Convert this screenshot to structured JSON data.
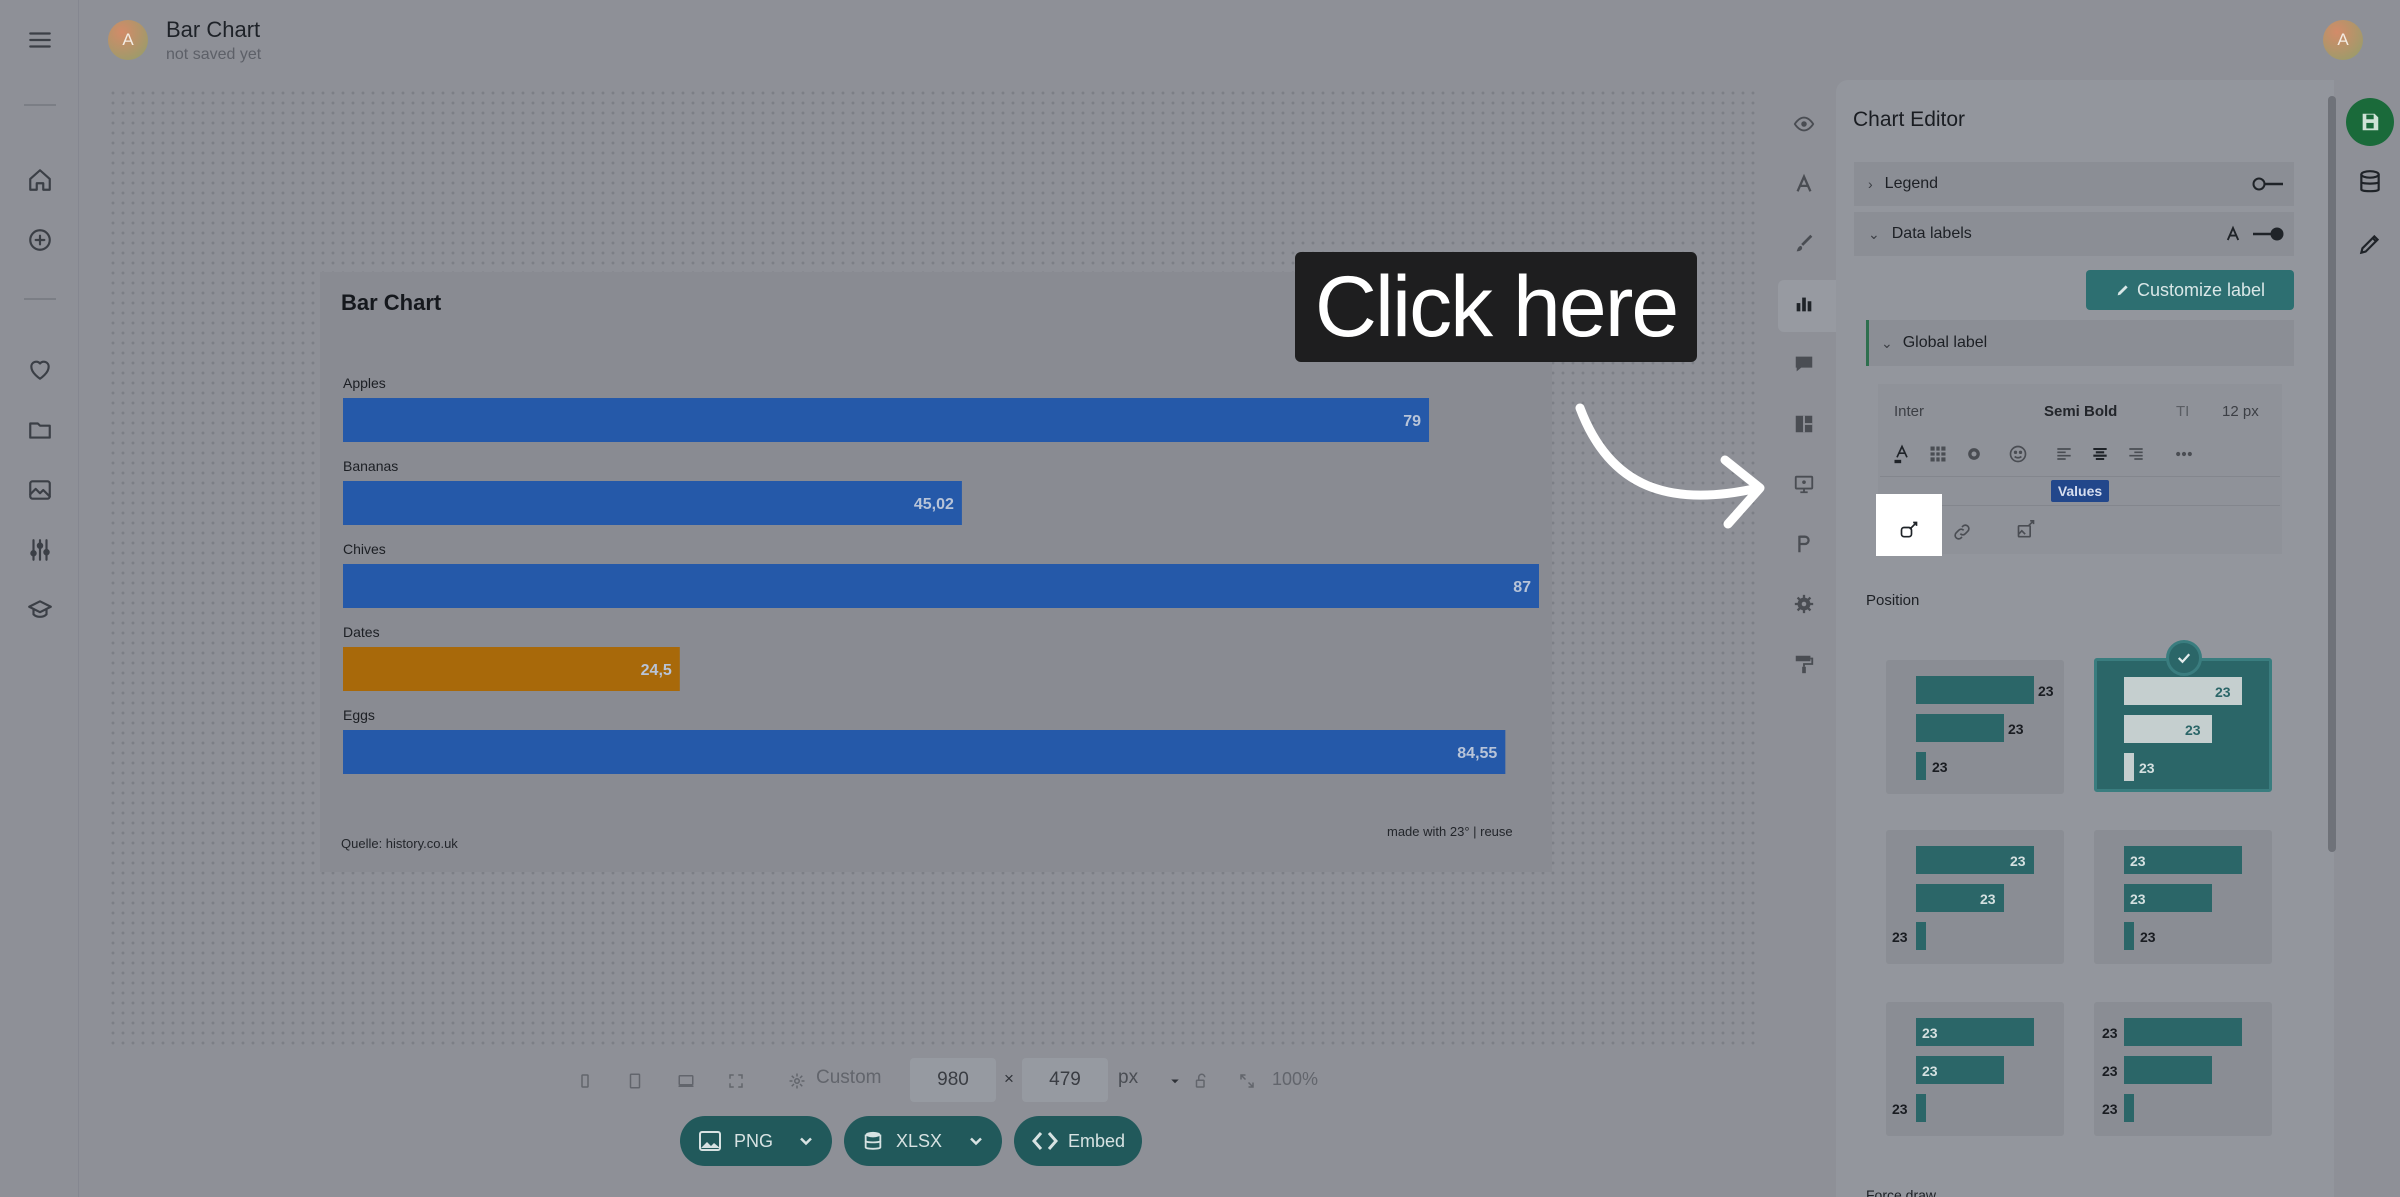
{
  "header": {
    "avatar_initial": "A",
    "title": "Bar Chart",
    "status": "not saved yet",
    "user_initial": "A"
  },
  "left_nav": {
    "items": [
      "menu-icon",
      "home-icon",
      "add-icon",
      "heart-icon",
      "folder-icon",
      "image-icon",
      "sliders-icon",
      "graduation-icon"
    ]
  },
  "chart_data": {
    "type": "bar",
    "orientation": "horizontal",
    "title": "Bar Chart",
    "categories": [
      "Apples",
      "Bananas",
      "Chives",
      "Dates",
      "Eggs"
    ],
    "values": [
      79,
      45.02,
      87,
      24.5,
      84.55
    ],
    "value_labels": [
      "79",
      "45,02",
      "87",
      "24,5",
      "84,55"
    ],
    "bar_colors": [
      "#2559a9",
      "#2559a9",
      "#2559a9",
      "#a8690a",
      "#2559a9"
    ],
    "xlim": [
      0,
      87
    ],
    "grid": false,
    "legend": "none",
    "source": "Quelle: history.co.uk",
    "credit": "made with 23° | reuse"
  },
  "toolbar": {
    "custom_label": "Custom",
    "width": "980",
    "times": "×",
    "height": "479",
    "unit": "px",
    "zoom": "100%",
    "export_png": "PNG",
    "export_xlsx": "XLSX",
    "embed": "Embed"
  },
  "editor": {
    "title": "Chart Editor",
    "legend_label": "Legend",
    "data_labels_label": "Data labels",
    "legend_enabled": false,
    "data_labels_enabled": true,
    "customize_label": "Customize label",
    "global_label": "Global label",
    "font_family": "Inter",
    "font_weight": "Semi Bold",
    "font_size": "12 px",
    "values_tag": "Values",
    "position_label": "Position",
    "position_sample": "23",
    "force_draw_label": "Force draw"
  },
  "callout": {
    "text": "Click here"
  },
  "colors": {
    "accent_teal": "#2b6668",
    "save_green": "#1a6a3a",
    "bar_blue": "#2559a9",
    "bar_highlight": "#a8690a"
  }
}
